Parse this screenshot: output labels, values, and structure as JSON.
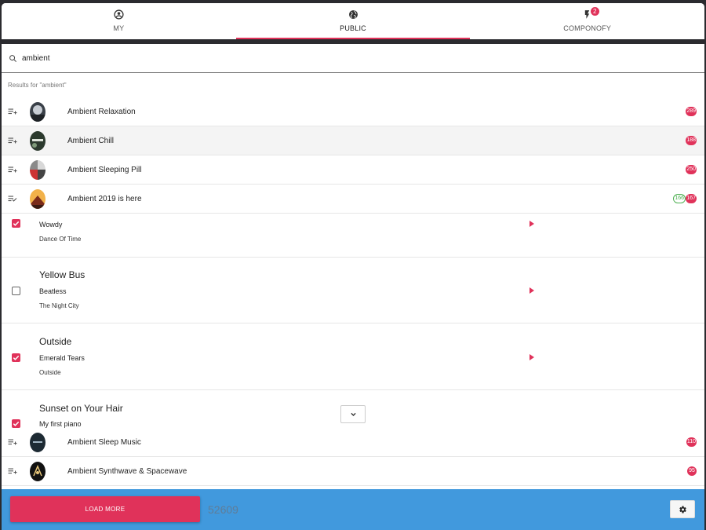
{
  "tabs": [
    {
      "label": "MY",
      "icon": "account-circle-icon"
    },
    {
      "label": "PUBLIC",
      "icon": "globe-icon",
      "active": true
    },
    {
      "label": "COMPONOFY",
      "icon": "flash-icon",
      "badge": "2"
    }
  ],
  "search": {
    "value": "ambient",
    "placeholder": ""
  },
  "results_label": "Results for \"ambient\"",
  "playlists": [
    {
      "title": "Ambient Relaxation",
      "count": "289"
    },
    {
      "title": "Ambient Chill",
      "count": "188"
    },
    {
      "title": "Ambient Sleeping Pill",
      "count": "250"
    },
    {
      "title": "Ambient 2019 is here",
      "selected_count": "166",
      "count": "167"
    },
    {
      "title": "Ambient Sleep Music",
      "count": "110"
    },
    {
      "title": "Ambient Synthwave & Spacewave",
      "count": "95"
    }
  ],
  "tracks": [
    {
      "title": "",
      "artist": "Wowdy",
      "album": "Dance Of Time",
      "checked": true
    },
    {
      "title": "Yellow Bus",
      "artist": "Beatless",
      "album": "The Night City",
      "checked": false
    },
    {
      "title": "Outside",
      "artist": "Emerald Tears",
      "album": "Outside",
      "checked": true
    },
    {
      "title": "Sunset on Your Hair",
      "artist": "My first piano",
      "album": "",
      "checked": true
    }
  ],
  "footer": {
    "load_more_label": "LOAD MORE",
    "total": "52609"
  },
  "colors": {
    "accent": "#e0325a",
    "footer": "#4199dd",
    "success": "#4caf50"
  }
}
